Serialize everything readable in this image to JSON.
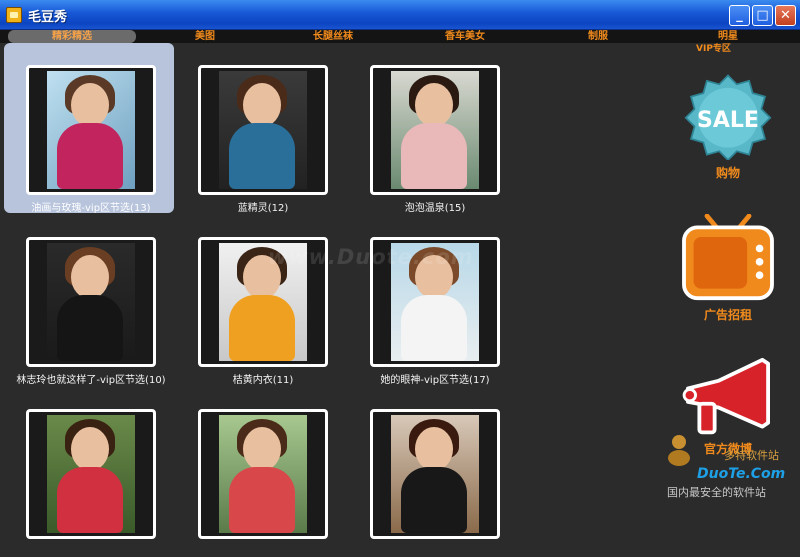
{
  "window": {
    "title": "毛豆秀",
    "minimize_label": "_",
    "maximize_label": "□",
    "close_label": "✕"
  },
  "menu": {
    "items": [
      {
        "label": "精彩精选",
        "active": true
      },
      {
        "label": "美图",
        "active": false
      },
      {
        "label": "长腿丝袜",
        "active": false
      },
      {
        "label": "香车美女",
        "active": false
      },
      {
        "label": "制服",
        "active": false
      },
      {
        "label": "明星",
        "active": false
      }
    ],
    "vip_label": "VIP专区"
  },
  "gallery": {
    "items": [
      {
        "caption": "油画与玫瑰-vip区节选(13)",
        "selected": true
      },
      {
        "caption": "蓝精灵(12)",
        "selected": false
      },
      {
        "caption": "泡泡温泉(15)",
        "selected": false
      },
      {
        "caption": "林志玲也就这样了-vip区节选(10)",
        "selected": false
      },
      {
        "caption": "桔黄内衣(11)",
        "selected": false
      },
      {
        "caption": "她的眼神-vip区节选(17)",
        "selected": false
      },
      {
        "caption": "",
        "selected": false
      },
      {
        "caption": "",
        "selected": false
      },
      {
        "caption": "",
        "selected": false
      }
    ]
  },
  "sidebar": {
    "sale_text": "SALE",
    "sale_label": "购物",
    "ad_label": "广告招租",
    "official_label": "官方微博"
  },
  "watermarks": {
    "center": "www.Duote.com",
    "brand": "DuoTe.Com",
    "tagline": "国内最安全的软件站",
    "site": "多特软件站"
  },
  "colors": {
    "accent": "#f08a1c",
    "background": "#2b2b2b",
    "titlebar": "#1757d6",
    "selection": "#b7c4dc"
  }
}
